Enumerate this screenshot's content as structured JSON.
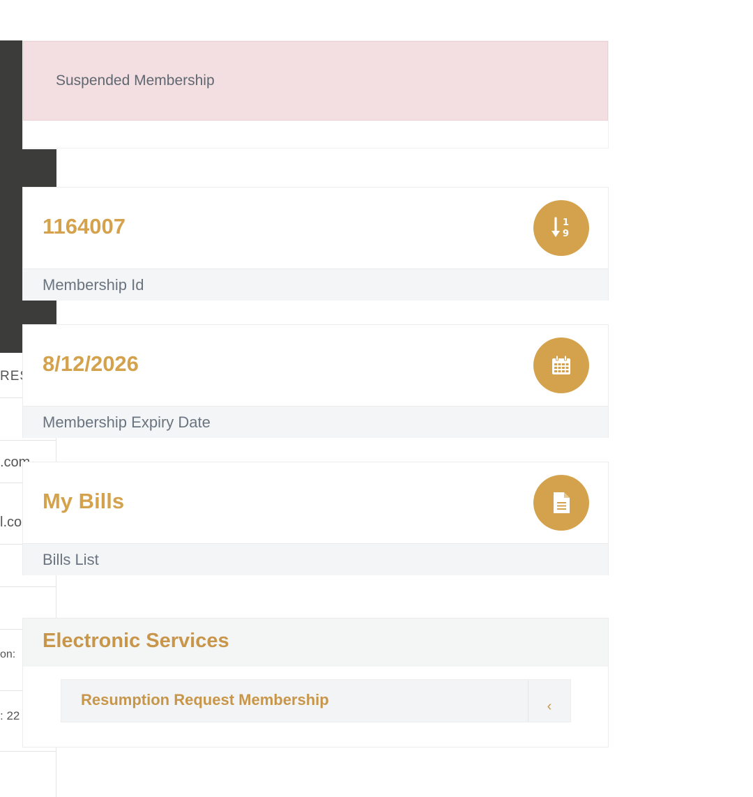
{
  "alert": {
    "text": "Suspended Membership"
  },
  "cards": [
    {
      "value": "1164007",
      "label": "Membership Id",
      "icon": "sort-numeric-icon"
    },
    {
      "value": "8/12/2026",
      "label": "Membership Expiry Date",
      "icon": "calendar-icon"
    },
    {
      "value": "My Bills",
      "label": "Bills List",
      "icon": "document-icon"
    }
  ],
  "services": {
    "title": "Electronic Services",
    "items": [
      {
        "label": "Resumption Request Membership",
        "chevron": "‹"
      }
    ]
  },
  "background_fragments": [
    "RES",
    ".com",
    "l.co",
    "on:",
    ": 22"
  ],
  "colors": {
    "accent": "#d4a24c",
    "alert_bg": "#f3dfe1",
    "sidebar_dark": "#3c3c3b"
  }
}
